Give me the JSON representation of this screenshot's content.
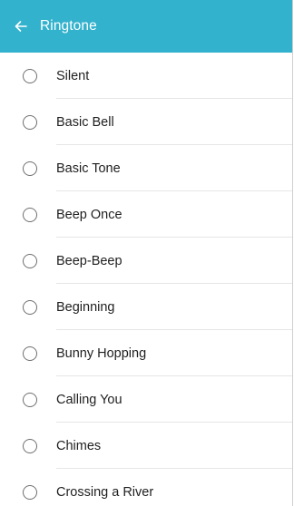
{
  "header": {
    "title": "Ringtone",
    "background": "#33b2cd",
    "back_icon": "arrow-left-icon"
  },
  "ringtones": [
    {
      "label": "Silent",
      "selected": false
    },
    {
      "label": "Basic Bell",
      "selected": false
    },
    {
      "label": "Basic Tone",
      "selected": false
    },
    {
      "label": "Beep Once",
      "selected": false
    },
    {
      "label": "Beep-Beep",
      "selected": false
    },
    {
      "label": "Beginning",
      "selected": false
    },
    {
      "label": "Bunny Hopping",
      "selected": false
    },
    {
      "label": "Calling You",
      "selected": false
    },
    {
      "label": "Chimes",
      "selected": false
    },
    {
      "label": "Crossing a River",
      "selected": false
    }
  ]
}
